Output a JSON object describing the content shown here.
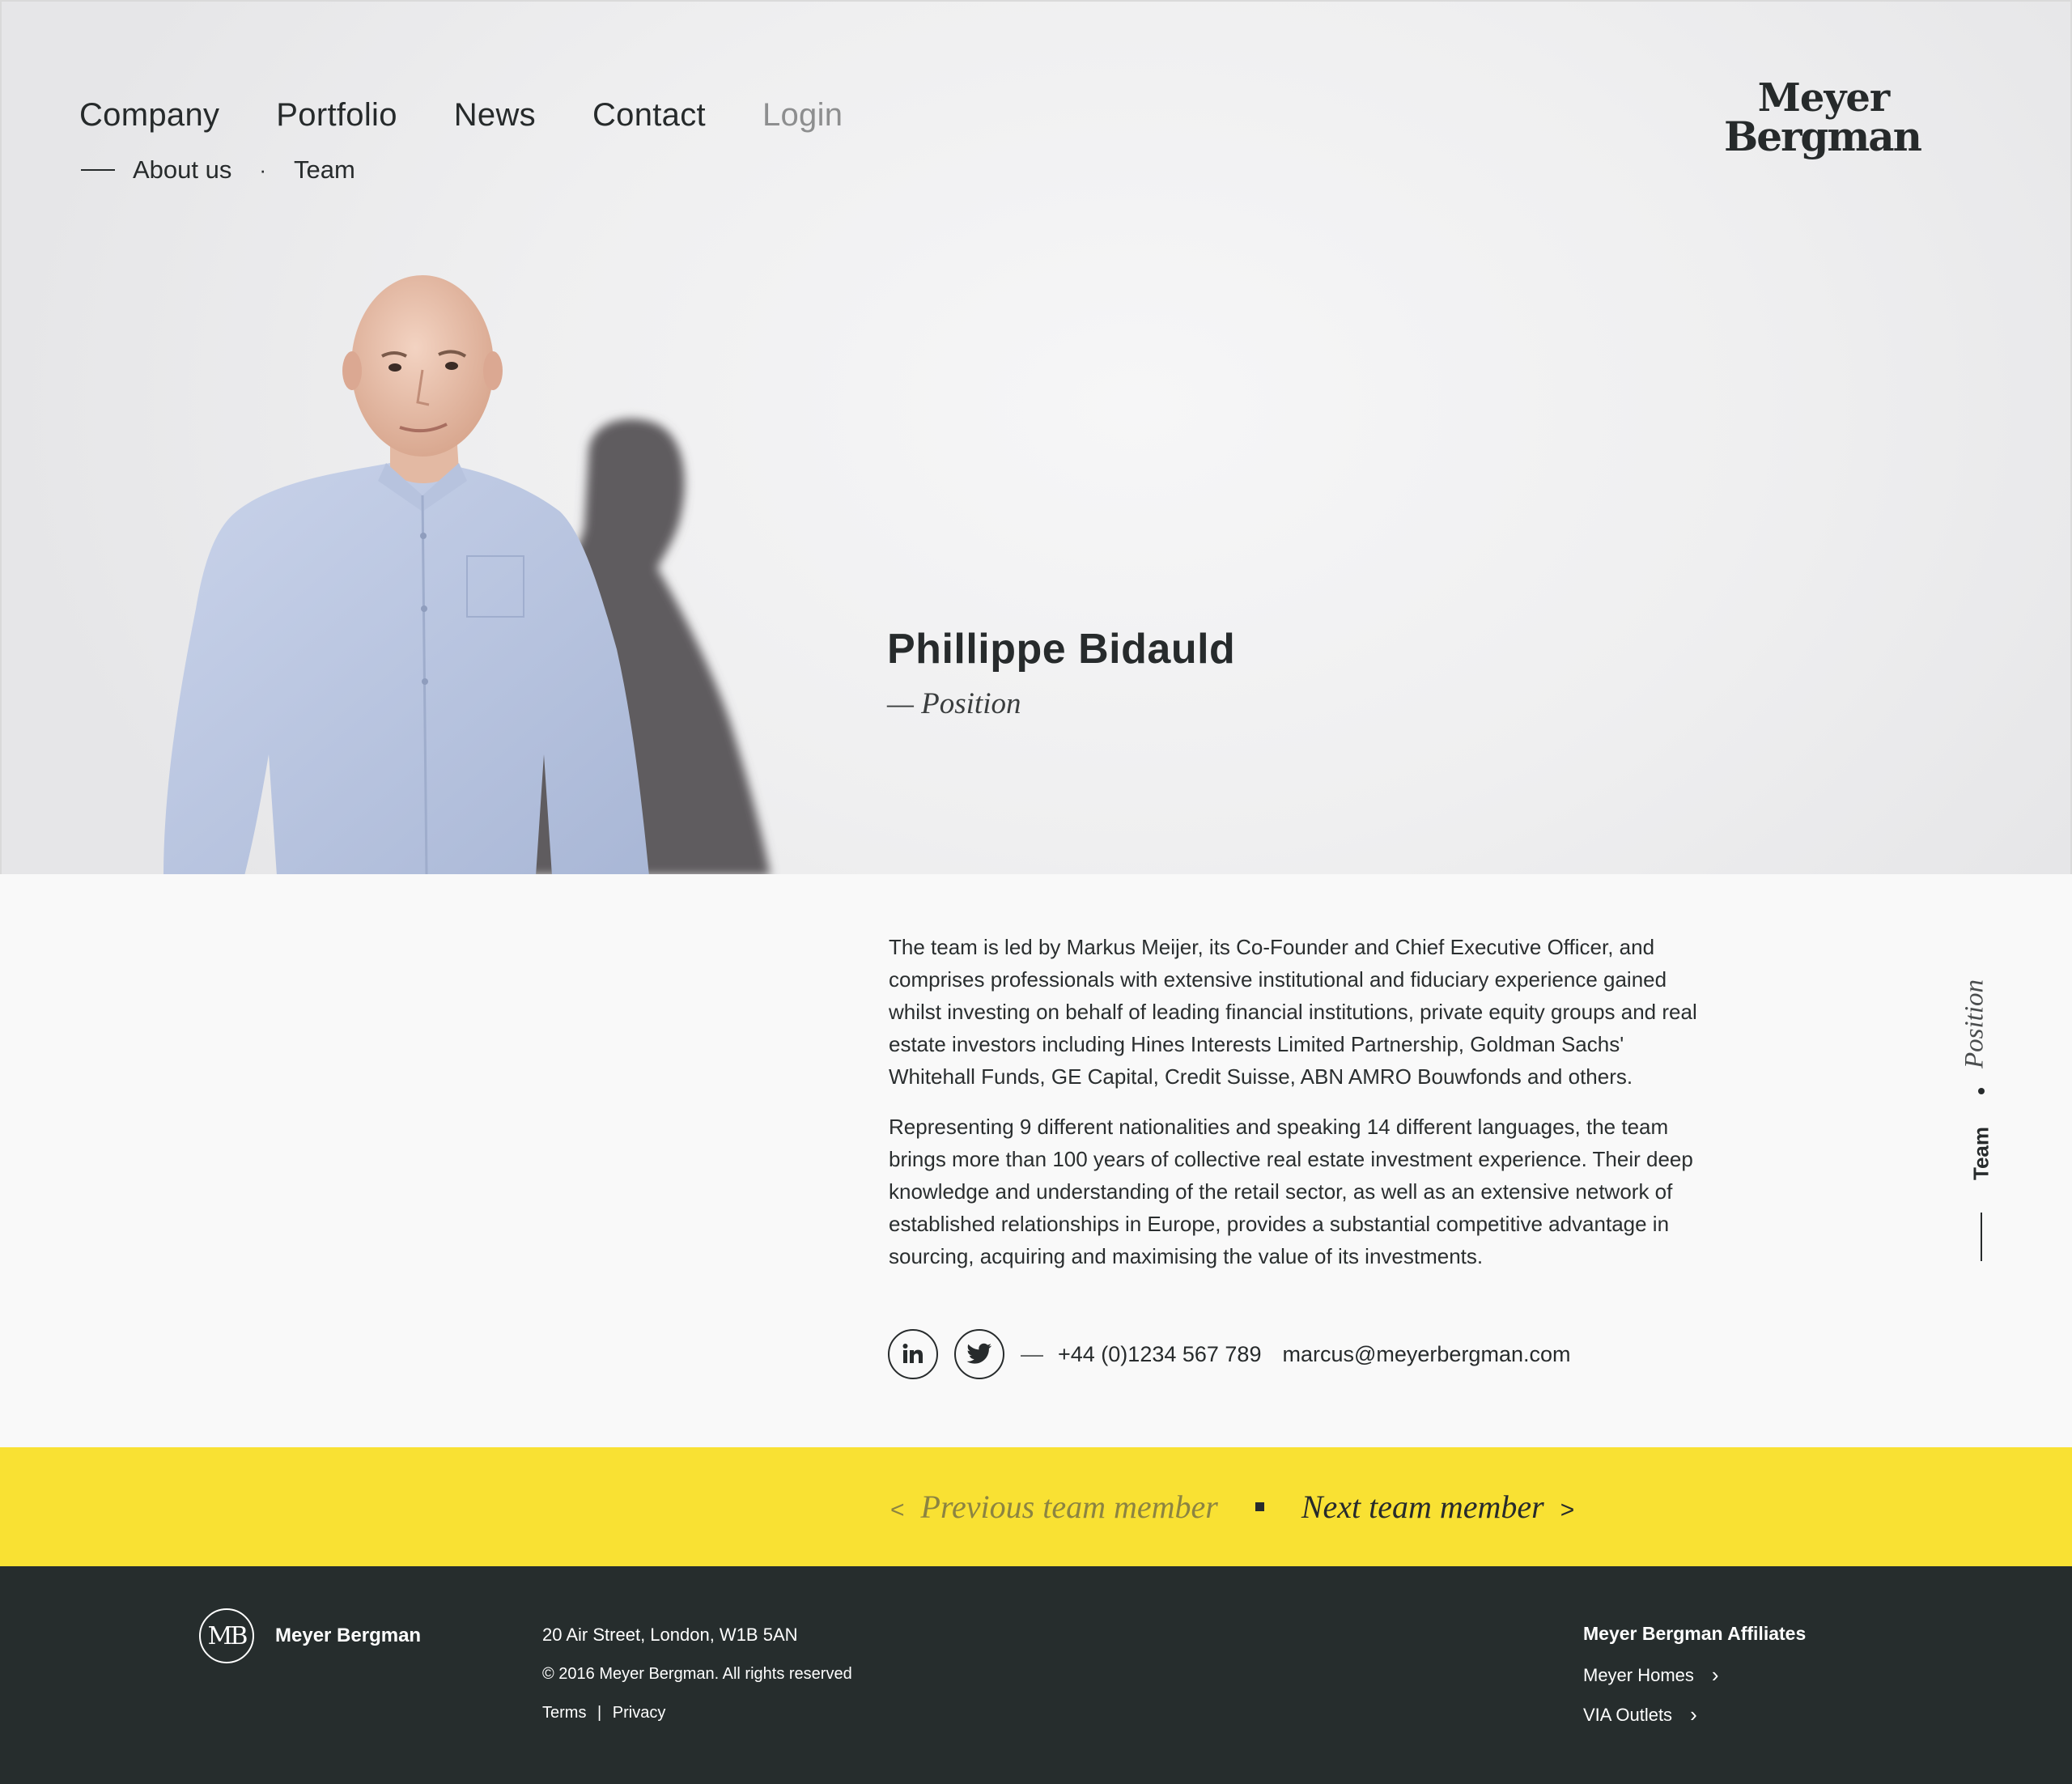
{
  "nav": {
    "items": [
      "Company",
      "Portfolio",
      "News",
      "Contact",
      "Login"
    ],
    "sub_items": [
      "About us",
      "Team"
    ]
  },
  "logo": {
    "line1": "Meyer",
    "line2": "Bergman"
  },
  "profile": {
    "name": "Phillippe Bidauld",
    "position": "— Position",
    "bio": [
      "The team is led by Markus Meijer, its Co-Founder and Chief Executive Officer, and comprises professionals with extensive institutional and fiduciary experience gained whilst investing on behalf of leading financial institutions, private equity groups and real estate investors including Hines Interests Limited Partnership, Goldman Sachs' Whitehall Funds, GE Capital, Credit Suisse, ABN AMRO Bouwfonds and others.",
      "Representing 9 different nationalities and speaking 14 different languages, the team brings more than 100 years of collective real estate investment experience. Their deep knowledge and understanding of the retail sector, as well as an extensive network of established relationships in Europe, provides a substantial competitive advantage in sourcing, acquiring and maximising the value of its investments."
    ],
    "dash": "—",
    "phone": "+44 (0)1234 567 789",
    "email": "marcus@meyerbergman.com",
    "social": [
      "linkedin-icon",
      "twitter-icon"
    ]
  },
  "side_label": {
    "position": "Position",
    "section": "Team"
  },
  "pager": {
    "prev_arrow": "<",
    "prev": "Previous team member",
    "next": "Next team member",
    "next_arrow": ">"
  },
  "footer": {
    "mark": "MB",
    "brand": "Meyer Bergman",
    "address": "20 Air Street, London, W1B 5AN",
    "copyright": "© 2016 Meyer Bergman. All rights reserved",
    "terms": "Terms",
    "sep": "|",
    "privacy": "Privacy",
    "affiliates_title": "Meyer Bergman Affiliates",
    "affiliates": [
      "Meyer Homes",
      "VIA Outlets"
    ]
  },
  "colors": {
    "accent_yellow": "#f9e133",
    "footer_bg": "#262d2d",
    "text": "#272b2c"
  }
}
